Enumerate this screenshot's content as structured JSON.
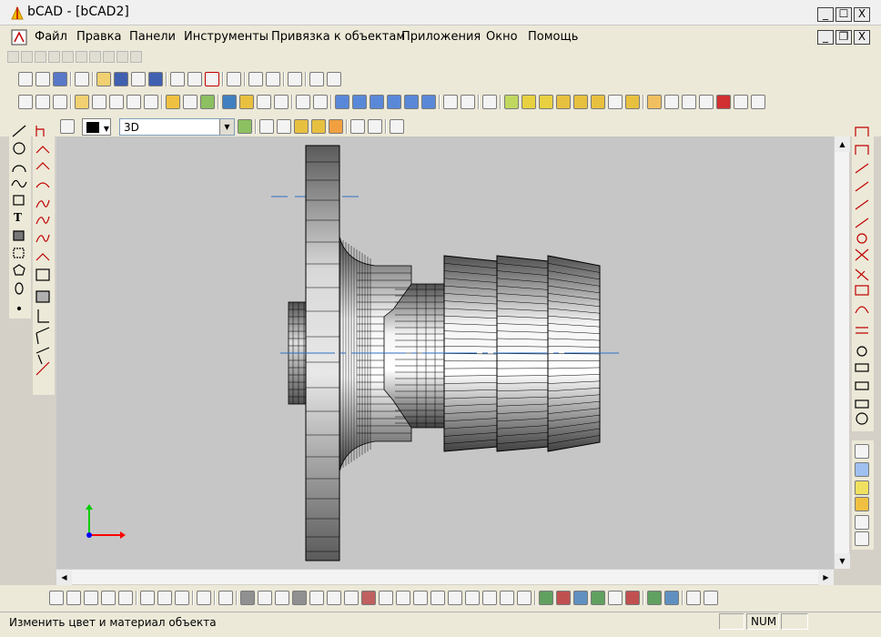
{
  "window": {
    "title": "bCAD - [bCAD2]",
    "minimize_glyph": "_",
    "maximize_glyph": "☐",
    "close_glyph": "X",
    "restore_glyph": "❐"
  },
  "menu": {
    "items": [
      "Файл",
      "Правка",
      "Панели",
      "Инструменты",
      "Привязка к объектам",
      "Приложения",
      "Окно",
      "Помощь"
    ]
  },
  "property_bar": {
    "view_mode": "3D",
    "current_color": "#000000"
  },
  "status": {
    "message": "Изменить цвет и материал объекта",
    "num": "NUM"
  },
  "left_toolbar_1": {
    "icons": [
      "line-tool-icon",
      "circle-tool-icon",
      "arc-tool-icon",
      "spline-tool-icon",
      "rectangle-tool-icon",
      "text-tool-icon",
      "hatch-tool-icon",
      "fill-tool-icon",
      "polygon-tool-icon",
      "ellipse-tool-icon",
      "point-tool-icon"
    ],
    "text_tool_glyph": "T"
  },
  "colors": {
    "axis_x": "#ff0000",
    "axis_y": "#00cc00",
    "axis_z": "#0000ff",
    "centerline": "#3070c0",
    "viewport_bg": "#c6c6c6",
    "mesh_line": "#000000"
  }
}
